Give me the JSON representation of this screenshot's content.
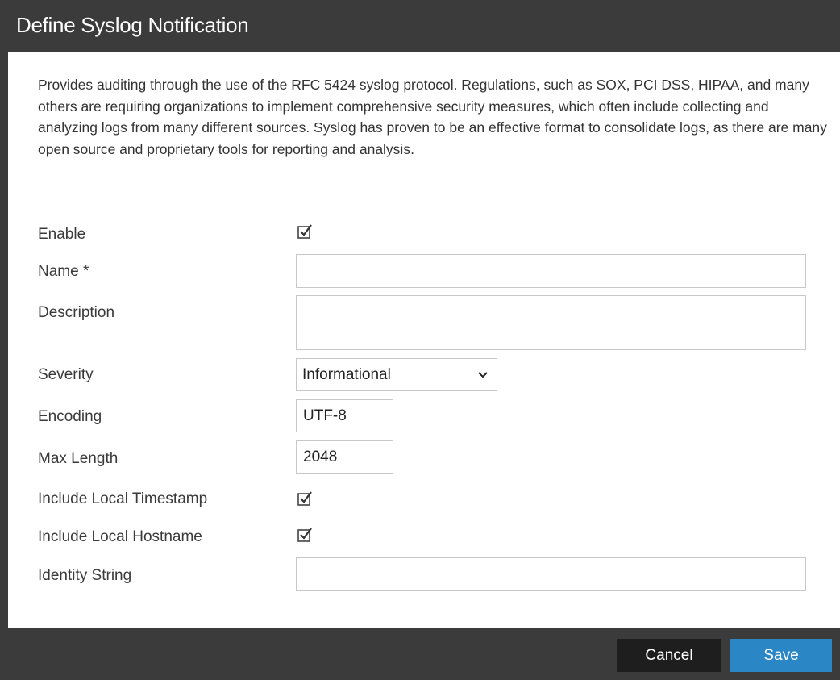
{
  "dialog": {
    "title": "Define Syslog Notification",
    "description": "Provides auditing through the use of the RFC 5424 syslog protocol. Regulations, such as SOX, PCI DSS, HIPAA, and many others are requiring organizations to implement comprehensive security measures, which often include collecting and analyzing logs from many different sources. Syslog has proven to be an effective format to consolidate logs, as there are many open source and proprietary tools for reporting and analysis."
  },
  "form": {
    "enable": {
      "label": "Enable",
      "checked": true
    },
    "name": {
      "label": "Name *",
      "value": ""
    },
    "description": {
      "label": "Description",
      "value": ""
    },
    "severity": {
      "label": "Severity",
      "value": "Informational",
      "icon": "chevron-down-icon"
    },
    "encoding": {
      "label": "Encoding",
      "value": "UTF-8"
    },
    "max_length": {
      "label": "Max Length",
      "value": "2048"
    },
    "include_local_timestamp": {
      "label": "Include Local Timestamp",
      "checked": true
    },
    "include_local_hostname": {
      "label": "Include Local Hostname",
      "checked": true
    },
    "identity_string": {
      "label": "Identity String",
      "value": ""
    }
  },
  "footer": {
    "cancel_label": "Cancel",
    "save_label": "Save"
  },
  "colors": {
    "titlebar": "#3b3b3b",
    "footer": "#3b3b3b",
    "cancel_button": "#1e1e1e",
    "save_button": "#2a86c4"
  }
}
